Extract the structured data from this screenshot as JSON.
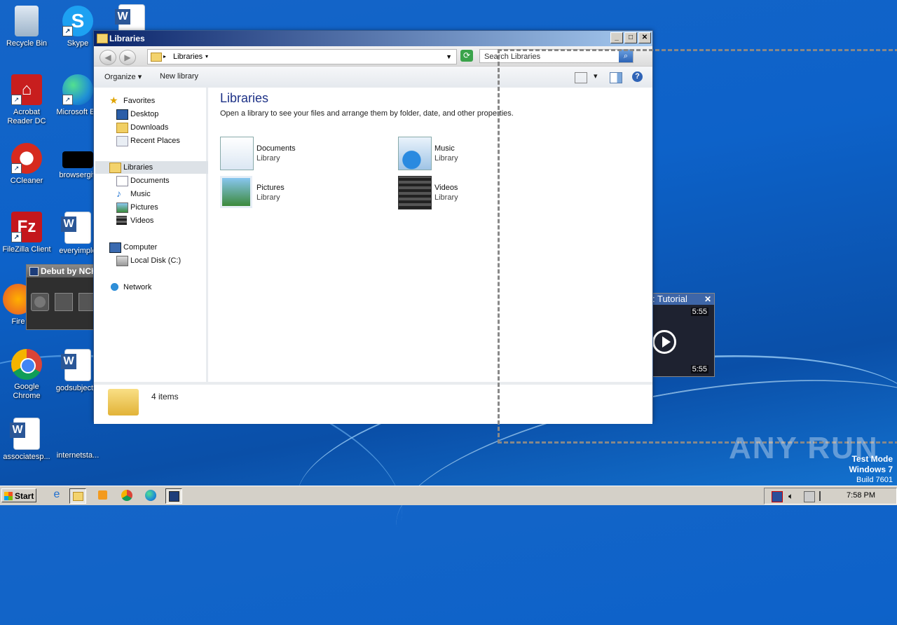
{
  "desktop": {
    "icons": [
      {
        "label": "Recycle Bin"
      },
      {
        "label": "Skype"
      },
      {
        "label": "Acrobat Reader DC"
      },
      {
        "label": "Microsoft Ed"
      },
      {
        "label": "CCleaner"
      },
      {
        "label": "browsergiv"
      },
      {
        "label": "FileZilla Client"
      },
      {
        "label": "everyimple"
      },
      {
        "label": "Fire"
      },
      {
        "label": "Google Chrome"
      },
      {
        "label": "godsubject..."
      },
      {
        "label": "associatesp..."
      },
      {
        "label": "internetsta..."
      }
    ]
  },
  "debut_widget": {
    "title": "Debut by NCH"
  },
  "video_widget": {
    "title": ": Tutorial",
    "duration_top": "5:55",
    "duration_bottom": "5:55"
  },
  "window": {
    "title": "Libraries",
    "address": {
      "crumb": "Libraries"
    },
    "search": {
      "placeholder": "Search Libraries"
    },
    "toolbar": {
      "organize": "Organize",
      "new_library": "New library"
    },
    "nav": {
      "favorites": "Favorites",
      "desktop": "Desktop",
      "downloads": "Downloads",
      "recent": "Recent Places",
      "libraries": "Libraries",
      "documents": "Documents",
      "music": "Music",
      "pictures": "Pictures",
      "videos": "Videos",
      "computer": "Computer",
      "local_disk": "Local Disk (C:)",
      "network": "Network"
    },
    "content": {
      "heading": "Libraries",
      "subtitle": "Open a library to see your files and arrange them by folder, date, and other properties.",
      "libraries": [
        {
          "name": "Documents",
          "kind": "Library"
        },
        {
          "name": "Music",
          "kind": "Library"
        },
        {
          "name": "Pictures",
          "kind": "Library"
        },
        {
          "name": "Videos",
          "kind": "Library"
        }
      ]
    },
    "status": {
      "count": "4 items"
    }
  },
  "watermark": {
    "brand": "ANY RUN",
    "line1": "Test Mode",
    "line2": "Windows 7",
    "line3": "Build 7601"
  },
  "taskbar": {
    "start": "Start",
    "clock": "7:58 PM"
  }
}
